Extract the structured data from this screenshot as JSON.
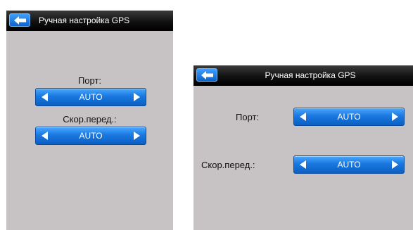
{
  "portrait": {
    "title": "Ручная настройка GPS",
    "port_label": "Порт:",
    "port_value": "AUTO",
    "speed_label": "Скор.перед.:",
    "speed_value": "AUTO"
  },
  "landscape": {
    "title": "Ручная настройка GPS",
    "port_label": "Порт:",
    "port_value": "AUTO",
    "speed_label": "Скор.перед.:",
    "speed_value": "AUTO"
  },
  "icons": {
    "back": "back-arrow-icon",
    "prev": "arrow-left-icon",
    "next": "arrow-right-icon"
  },
  "colors": {
    "screen_bg": "#c7c2c4",
    "titlebar": "#000000",
    "accent": "#1a78e0"
  }
}
